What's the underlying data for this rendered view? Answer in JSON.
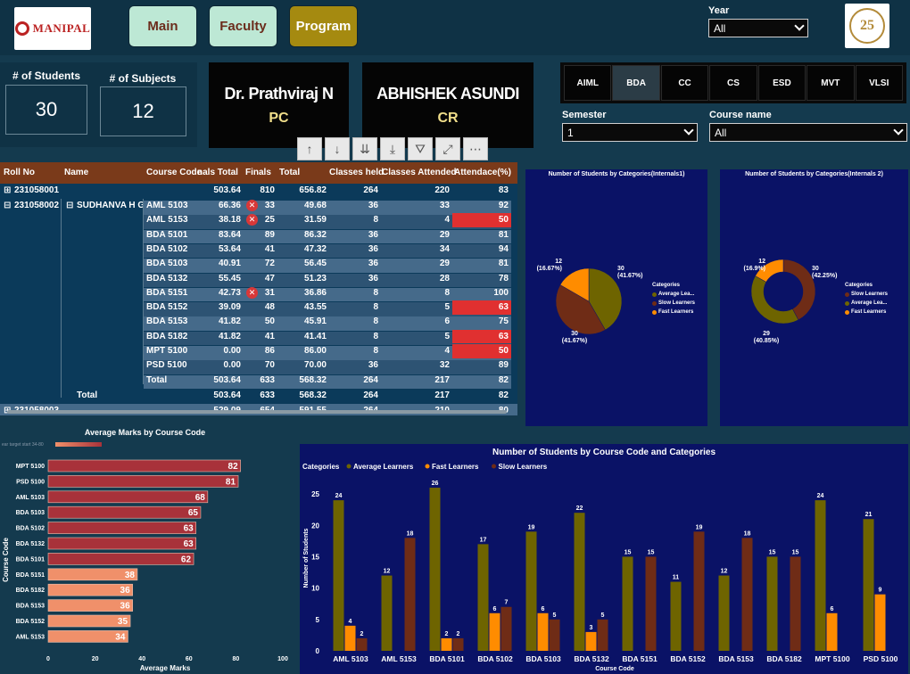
{
  "header": {
    "logo_left_text": "MANIPAL",
    "logo_right_text": "25",
    "nav": [
      {
        "label": "Main"
      },
      {
        "label": "Faculty"
      },
      {
        "label": "Program"
      }
    ],
    "year": {
      "title": "Year",
      "value": "All"
    }
  },
  "kpis": {
    "students_label": "# of Students",
    "students_value": "30",
    "subjects_label": "# of Subjects",
    "subjects_value": "12"
  },
  "pc_card": {
    "name": "Dr. Prathviraj N",
    "role": "PC"
  },
  "cr_card": {
    "name": "ABHISHEK ASUNDI",
    "role": "CR"
  },
  "programs": [
    "AIML",
    "BDA",
    "CC",
    "CS",
    "ESD",
    "MVT",
    "VLSI"
  ],
  "semester": {
    "title": "Semester",
    "value": "1"
  },
  "course_name": {
    "title": "Course name",
    "value": "All"
  },
  "toolbar_icons": [
    "sort-ascending-icon",
    "sort-descending-icon",
    "expand-next-level-icon",
    "drill-down-icon",
    "filter-icon",
    "focus-mode-icon",
    "more-options-icon"
  ],
  "matrix": {
    "columns": [
      "Roll No",
      "Name",
      "Course Code",
      "nals Total",
      "Finals",
      "Total",
      "Classes held",
      "Classes Attended",
      "Attendace(%)"
    ],
    "top_row": {
      "roll": "231058001",
      "internals": "503.64",
      "finals": "810",
      "total": "656.82",
      "held": "264",
      "attended": "220",
      "att": "83"
    },
    "student": {
      "roll": "231058002",
      "name": "SUDHANVA H G"
    },
    "rows": [
      {
        "code": "AML 5103",
        "internals": "66.36",
        "finals": "33",
        "total": "49.68",
        "held": "36",
        "attended": "33",
        "att": "92",
        "x": true,
        "alert": false
      },
      {
        "code": "AML 5153",
        "internals": "38.18",
        "finals": "25",
        "total": "31.59",
        "held": "8",
        "attended": "4",
        "att": "50",
        "x": true,
        "alert": true
      },
      {
        "code": "BDA 5101",
        "internals": "83.64",
        "finals": "89",
        "total": "86.32",
        "held": "36",
        "attended": "29",
        "att": "81",
        "x": false,
        "alert": false
      },
      {
        "code": "BDA 5102",
        "internals": "53.64",
        "finals": "41",
        "total": "47.32",
        "held": "36",
        "attended": "34",
        "att": "94",
        "x": false,
        "alert": false
      },
      {
        "code": "BDA 5103",
        "internals": "40.91",
        "finals": "72",
        "total": "56.45",
        "held": "36",
        "attended": "29",
        "att": "81",
        "x": false,
        "alert": false
      },
      {
        "code": "BDA 5132",
        "internals": "55.45",
        "finals": "47",
        "total": "51.23",
        "held": "36",
        "attended": "28",
        "att": "78",
        "x": false,
        "alert": false
      },
      {
        "code": "BDA 5151",
        "internals": "42.73",
        "finals": "31",
        "total": "36.86",
        "held": "8",
        "attended": "8",
        "att": "100",
        "x": true,
        "alert": false
      },
      {
        "code": "BDA 5152",
        "internals": "39.09",
        "finals": "48",
        "total": "43.55",
        "held": "8",
        "attended": "5",
        "att": "63",
        "x": false,
        "alert": true
      },
      {
        "code": "BDA 5153",
        "internals": "41.82",
        "finals": "50",
        "total": "45.91",
        "held": "8",
        "attended": "6",
        "att": "75",
        "x": false,
        "alert": false
      },
      {
        "code": "BDA 5182",
        "internals": "41.82",
        "finals": "41",
        "total": "41.41",
        "held": "8",
        "attended": "5",
        "att": "63",
        "x": false,
        "alert": true
      },
      {
        "code": "MPT 5100",
        "internals": "0.00",
        "finals": "86",
        "total": "86.00",
        "held": "8",
        "attended": "4",
        "att": "50",
        "x": false,
        "alert": true
      },
      {
        "code": "PSD 5100",
        "internals": "0.00",
        "finals": "70",
        "total": "70.00",
        "held": "36",
        "attended": "32",
        "att": "89",
        "x": false,
        "alert": false
      }
    ],
    "subtotal": {
      "label": "Total",
      "internals": "503.64",
      "finals": "633",
      "total": "568.32",
      "held": "264",
      "attended": "217",
      "att": "82"
    },
    "total": {
      "label": "Total",
      "internals": "503.64",
      "finals": "633",
      "total": "568.32",
      "held": "264",
      "attended": "217",
      "att": "82"
    },
    "next_row": {
      "roll": "231058003",
      "internals": "529.09",
      "finals": "654",
      "total": "591.55",
      "held": "264",
      "attended": "210",
      "att": "80"
    }
  },
  "chart_data": [
    {
      "type": "pie",
      "title": "Number of Students by Categories(Internals1)",
      "legend_title": "Categories",
      "slices": [
        {
          "name": "Average Lea...",
          "value": 30,
          "pct": "41.67%",
          "color": "#6e6400"
        },
        {
          "name": "Slow Learners",
          "value": 30,
          "pct": "41.67%",
          "color": "#6f2c16"
        },
        {
          "name": "Fast Learners",
          "value": 12,
          "pct": "16.67%",
          "color": "#ff8c00"
        }
      ],
      "legend_placement": "right"
    },
    {
      "type": "pie",
      "donut": true,
      "title": "Number of Students by Categories(Internals 2)",
      "legend_title": "Categories",
      "slices": [
        {
          "name": "Slow Learners",
          "value": 30,
          "pct": "42.25%",
          "color": "#6f2c16"
        },
        {
          "name": "Average Lea...",
          "value": 29,
          "pct": "40.85%",
          "color": "#6e6400"
        },
        {
          "name": "Fast Learners",
          "value": 12,
          "pct": "16.9%",
          "color": "#ff8c00"
        }
      ],
      "legend_placement": "right"
    },
    {
      "type": "bar",
      "orientation": "horizontal",
      "title": "Average Marks by Course Code",
      "legend_text": "ear target start 34-80",
      "xlabel": "Average Marks",
      "ylabel": "Course Code",
      "xlim": [
        0,
        100
      ],
      "xticks": [
        0,
        20,
        40,
        60,
        80,
        100
      ],
      "categories": [
        "MPT 5100",
        "PSD 5100",
        "AML 5103",
        "BDA 5103",
        "BDA 5102",
        "BDA 5132",
        "BDA 5101",
        "BDA 5151",
        "BDA 5182",
        "BDA 5153",
        "BDA 5152",
        "AML 5153"
      ],
      "values": [
        82,
        81,
        68,
        65,
        63,
        63,
        62,
        38,
        36,
        36,
        35,
        34
      ],
      "colors": {
        "high": "#a8323a",
        "low": "#f0906a"
      }
    },
    {
      "type": "bar",
      "title": "Number of Students by Course Code and Categories",
      "legend_title": "Categories",
      "legend_placement": "top-left",
      "xlabel": "Course Code",
      "ylabel": "Number of Students",
      "ylim": [
        0,
        27
      ],
      "yticks": [
        0,
        5,
        10,
        15,
        20,
        25
      ],
      "categories": [
        "AML 5103",
        "AML 5153",
        "BDA 5101",
        "BDA 5102",
        "BDA 5103",
        "BDA 5132",
        "BDA 5151",
        "BDA 5152",
        "BDA 5153",
        "BDA 5182",
        "MPT 5100",
        "PSD 5100"
      ],
      "series": [
        {
          "name": "Average Learners",
          "color": "#6e6400",
          "values": [
            24,
            12,
            26,
            17,
            19,
            22,
            15,
            11,
            12,
            15,
            24,
            21
          ]
        },
        {
          "name": "Fast Learners",
          "color": "#ff8c00",
          "values": [
            4,
            null,
            2,
            6,
            6,
            3,
            null,
            null,
            null,
            null,
            6,
            9
          ]
        },
        {
          "name": "Slow Learners",
          "color": "#6f2c16",
          "values": [
            2,
            18,
            2,
            7,
            5,
            5,
            15,
            19,
            18,
            15,
            null,
            null
          ]
        }
      ]
    }
  ]
}
